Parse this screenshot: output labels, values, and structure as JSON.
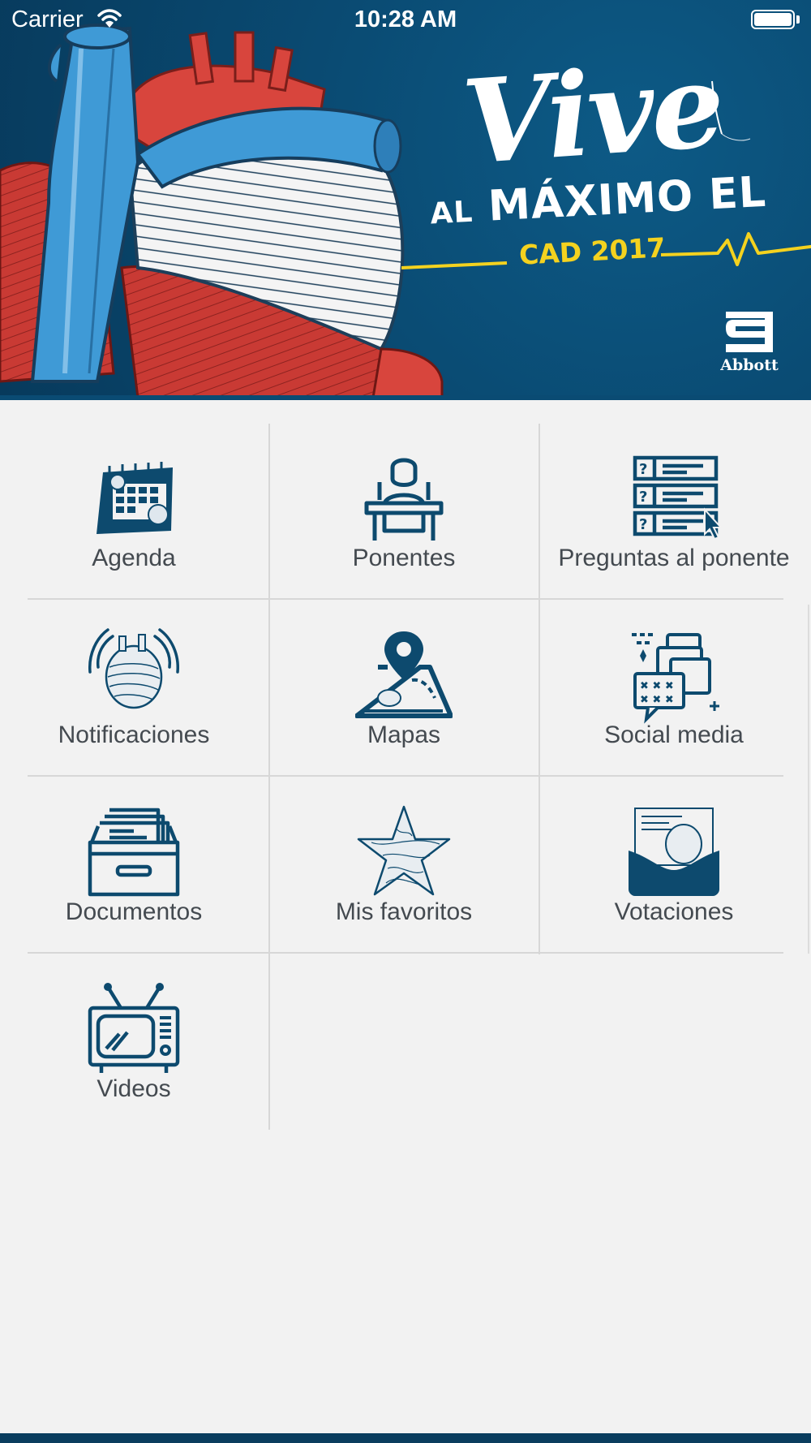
{
  "status_bar": {
    "carrier": "Carrier",
    "time": "10:28 AM",
    "wifi_icon": "wifi-icon",
    "battery_icon": "battery-icon"
  },
  "banner": {
    "title_script": "Vive",
    "title_small": "AL",
    "title_main": "MÁXIMO EL",
    "subtitle": "CAD 2017",
    "brand": "Abbott",
    "colors": {
      "background": "#0a4b73",
      "accent": "#f4d21f",
      "heart_red": "#d8453d",
      "heart_blue": "#3f9ad6"
    }
  },
  "menu": {
    "items": [
      {
        "label": "Agenda",
        "icon": "calendar-icon"
      },
      {
        "label": "Ponentes",
        "icon": "speaker-podium-icon"
      },
      {
        "label": "Preguntas al ponente",
        "icon": "questions-list-icon"
      },
      {
        "label": "Notificaciones",
        "icon": "heart-notification-icon"
      },
      {
        "label": "Mapas",
        "icon": "map-pin-icon"
      },
      {
        "label": "Social media",
        "icon": "chat-bubbles-icon"
      },
      {
        "label": "Documentos",
        "icon": "file-drawer-icon"
      },
      {
        "label": "Mis favoritos",
        "icon": "star-icon"
      },
      {
        "label": "Votaciones",
        "icon": "ballot-box-icon"
      },
      {
        "label": "Videos",
        "icon": "television-icon"
      }
    ],
    "icon_color": "#0d4a6e",
    "label_color": "#444a50"
  }
}
